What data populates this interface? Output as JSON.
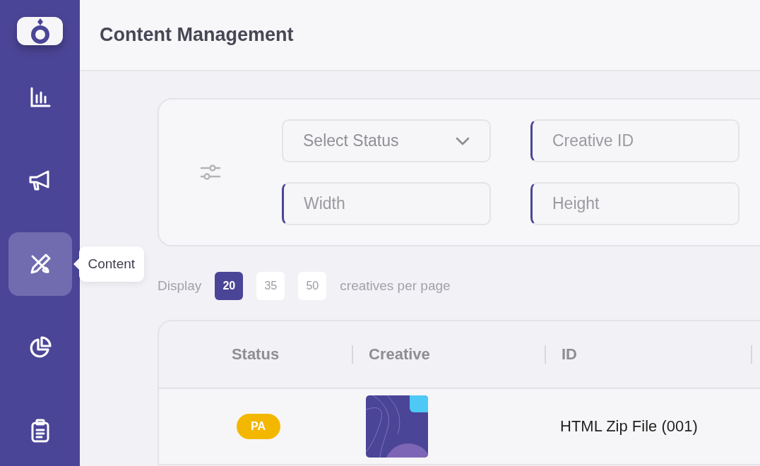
{
  "sidebar": {
    "items": [
      {
        "selected": false
      },
      {
        "selected": false
      },
      {
        "selected": true
      },
      {
        "selected": false
      },
      {
        "selected": false
      }
    ],
    "tooltip": "Content"
  },
  "header": {
    "title": "Content Management"
  },
  "filters": [
    {
      "kind": "select",
      "placeholder": "Select Status"
    },
    {
      "kind": "input",
      "placeholder": "Creative ID"
    },
    {
      "kind": "input",
      "placeholder": "Width"
    },
    {
      "kind": "input",
      "placeholder": "Height"
    }
  ],
  "page_size": {
    "label": "Display",
    "options": [
      {
        "label": "20",
        "selected": true
      },
      {
        "label": "35",
        "selected": false
      },
      {
        "label": "50",
        "selected": false
      }
    ],
    "suffix": "creatives per page"
  },
  "table": {
    "columns": [
      "Status",
      "Creative",
      "ID"
    ],
    "rows": [
      {
        "status": "PA",
        "id": "HTML Zip File (001)"
      }
    ]
  }
}
